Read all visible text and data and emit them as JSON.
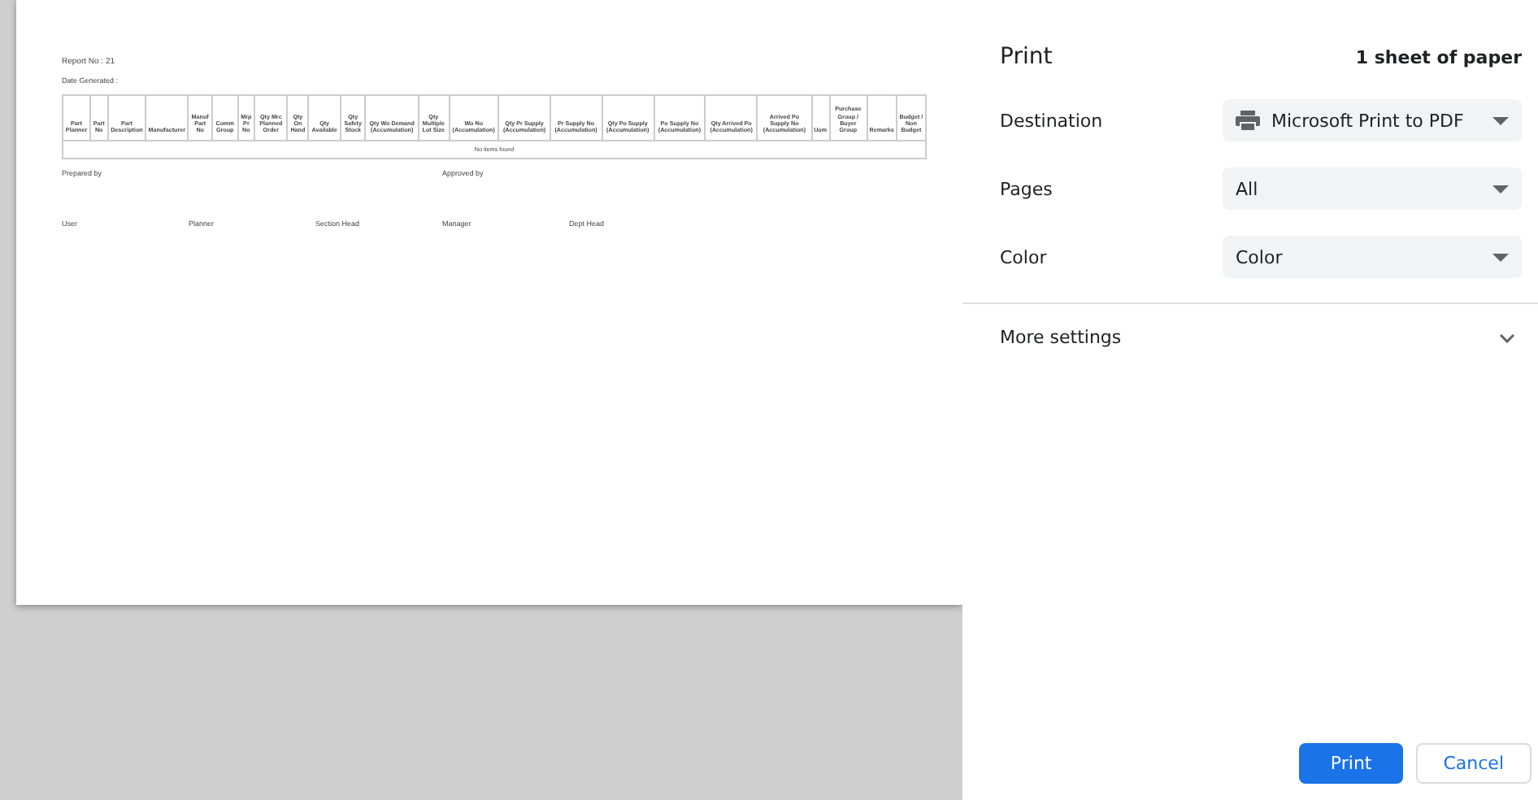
{
  "preview": {
    "report_title": "Report No : 21",
    "date_generated": "Date Generated :",
    "table": {
      "columns": [
        "Part Planner",
        "Part No",
        "Part Description",
        "Manufacturer",
        "Manuf Part No",
        "Comm Group",
        "Mrp Pr No",
        "Qty Mrc Planned Order",
        "Qty On Hand",
        "Qty Available",
        "Qty Safety Stock",
        "Qty Wo Demand (Accumulation)",
        "Qty Multiple Lot Size",
        "Wo No (Accumulation)",
        "Qty Pr Supply (Accumulation)",
        "Pr Supply No (Accumulation)",
        "Qty Po Supply (Accumulation)",
        "Po Supply No (Accumulation)",
        "Qty Arrived Po (Accumulation)",
        "Arrived Po Supply No (Accumulation)",
        "Uom",
        "Purchase Group / Buyer Group",
        "Remarks",
        "Budget / Non Budget"
      ],
      "empty_message": "No items found"
    },
    "signatures": {
      "prepared_by": "Prepared by",
      "approved_by": "Approved by",
      "roles": [
        "User",
        "Planner",
        "Section Head",
        "Manager",
        "Dept Head"
      ]
    }
  },
  "panel": {
    "title": "Print",
    "sheet_count": "1 sheet of paper",
    "settings": [
      {
        "label": "Destination",
        "value": "Microsoft Print to PDF"
      },
      {
        "label": "Pages",
        "value": "All"
      },
      {
        "label": "Color",
        "value": "Color"
      }
    ],
    "more_settings": {
      "label": "More settings",
      "expanded": false
    },
    "buttons": [
      {
        "label": "Print",
        "kind": "primary"
      },
      {
        "label": "Cancel",
        "kind": "secondary"
      }
    ]
  }
}
